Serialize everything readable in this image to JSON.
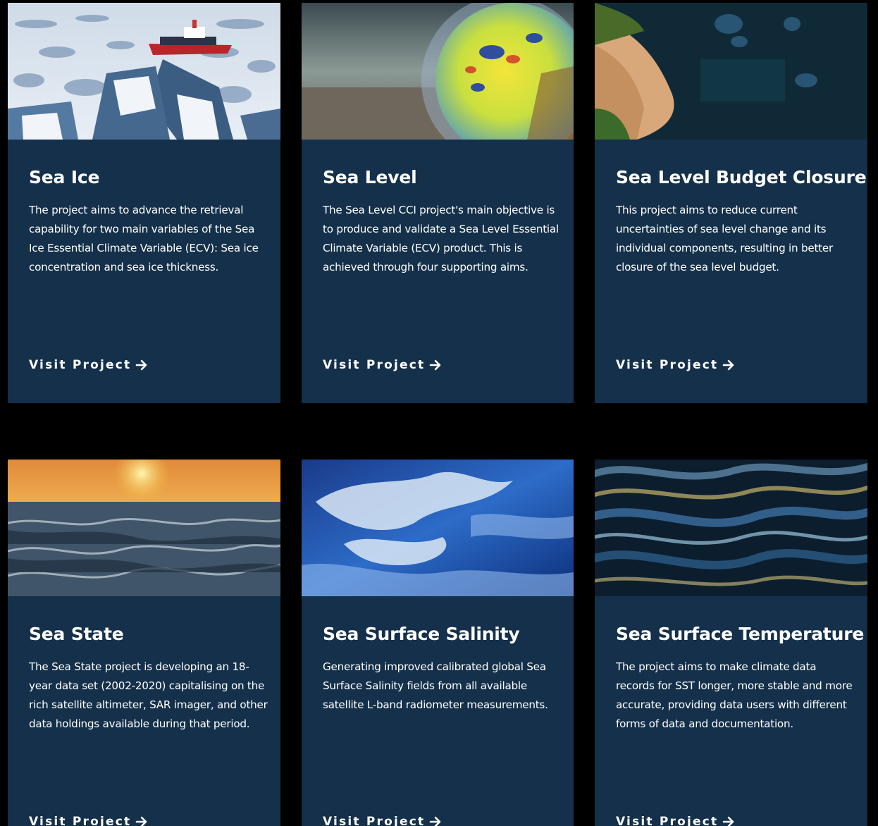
{
  "cards": [
    {
      "title": "Sea Ice",
      "description": "The project aims to advance the retrieval capability for two main variables of the Sea Ice Essential Climate Variable (ECV): Sea ice concentration and sea ice thickness.",
      "link_label": "Visit Project",
      "image": "sea-ice-icebreaker-image"
    },
    {
      "title": "Sea Level",
      "description": "The Sea Level CCI project's main objective is to produce and validate a Sea Level Essential Climate Variable (ECV) product. This is achieved through four supporting aims.",
      "link_label": "Visit Project",
      "image": "sea-level-globe-image"
    },
    {
      "title": "Sea Level Budget Closure",
      "description": "This project aims to reduce current uncertainties of sea level change and its individual components, resulting in better closure of the sea level budget.",
      "link_label": "Visit Project",
      "image": "satellite-coastline-image"
    },
    {
      "title": "Sea State",
      "description": "The Sea State project is developing an 18-year data set (2002-2020) capitalising on the rich satellite altimeter, SAR imager, and other data holdings available during that period.",
      "link_label": "Visit Project",
      "image": "sunset-waves-image"
    },
    {
      "title": "Sea Surface Salinity",
      "description": "Generating improved calibrated global Sea Surface Salinity fields from all available satellite L-band radiometer measurements.",
      "link_label": "Visit Project",
      "image": "blue-surf-image"
    },
    {
      "title": "Sea Surface Temperature",
      "description": "The project aims to make climate data records for SST longer, more stable and more accurate, providing data users with different forms of data and documentation.",
      "link_label": "Visit Project",
      "image": "flowing-water-image"
    }
  ],
  "colors": {
    "background": "#000000",
    "card": "#14304a",
    "text": "#ffffff"
  },
  "icons": {
    "link_arrow": "arrow-right-icon"
  }
}
